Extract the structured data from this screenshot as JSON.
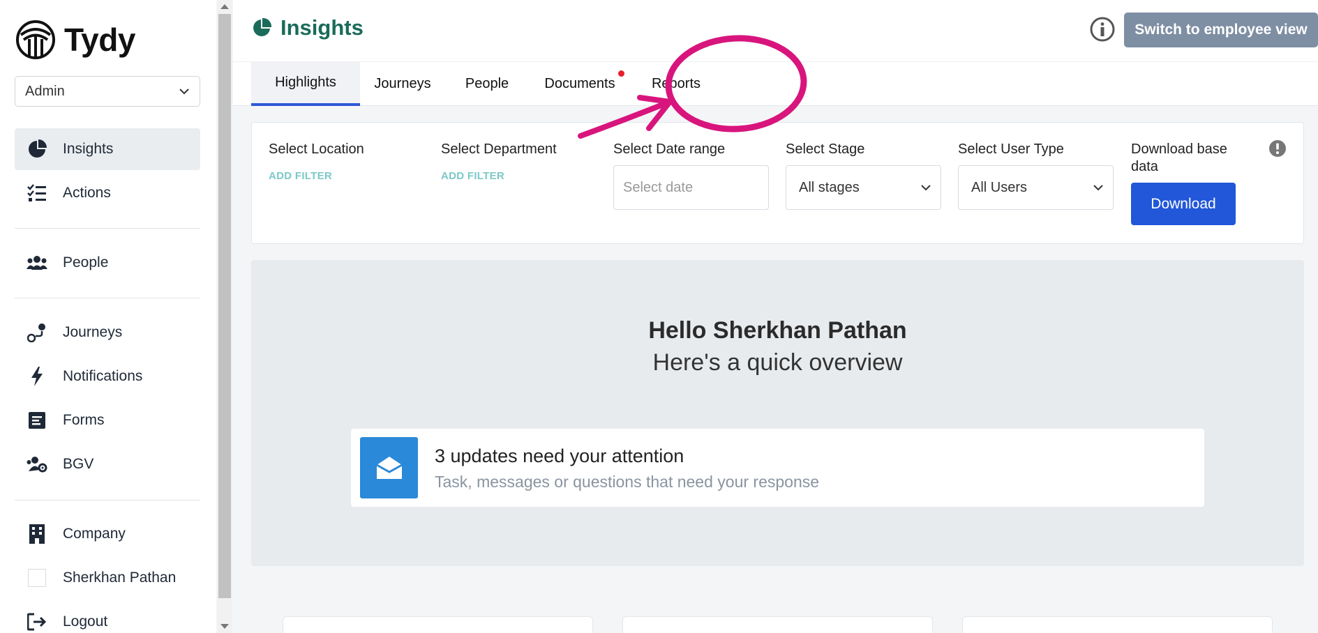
{
  "brand": {
    "name": "Tydy"
  },
  "role_select": {
    "value": "Admin"
  },
  "sidebar": {
    "items": [
      {
        "label": "Insights",
        "icon": "pie-chart-icon",
        "active": true
      },
      {
        "label": "Actions",
        "icon": "checklist-icon"
      },
      {
        "label": "People",
        "icon": "users-icon"
      },
      {
        "label": "Journeys",
        "icon": "route-icon"
      },
      {
        "label": "Notifications",
        "icon": "bolt-icon"
      },
      {
        "label": "Forms",
        "icon": "form-icon"
      },
      {
        "label": "BGV",
        "icon": "users-gear-icon"
      },
      {
        "label": "Company",
        "icon": "building-icon"
      },
      {
        "label": "Sherkhan Pathan",
        "icon": "avatar"
      },
      {
        "label": "Logout",
        "icon": "logout-icon"
      }
    ]
  },
  "header": {
    "title": "Insights",
    "switch_label": "Switch to employee view"
  },
  "tabs": [
    {
      "label": "Highlights",
      "active": true
    },
    {
      "label": "Journeys"
    },
    {
      "label": "People"
    },
    {
      "label": "Documents",
      "badge_dot": true
    },
    {
      "label": "Reports"
    }
  ],
  "filters": {
    "location": {
      "label": "Select Location",
      "action": "ADD FILTER"
    },
    "department": {
      "label": "Select Department",
      "action": "ADD FILTER"
    },
    "date_range": {
      "label": "Select Date range",
      "placeholder": "Select date"
    },
    "stage": {
      "label": "Select Stage",
      "value": "All stages"
    },
    "user_type": {
      "label": "Select User Type",
      "value": "All Users"
    },
    "download": {
      "label_line1": "Download base",
      "label_line2": "data",
      "button": "Download"
    }
  },
  "overview": {
    "greeting": "Hello Sherkhan Pathan",
    "subtitle": "Here's a quick overview",
    "attention_title": "3 updates need your attention",
    "attention_sub": "Task, messages or questions that need your response"
  },
  "colors": {
    "accent_green": "#1b6b5a",
    "primary_blue": "#2157d8",
    "tab_underline": "#2e58d6",
    "annotation_pink": "#d8157d",
    "badge_red": "#ea1d2c"
  }
}
